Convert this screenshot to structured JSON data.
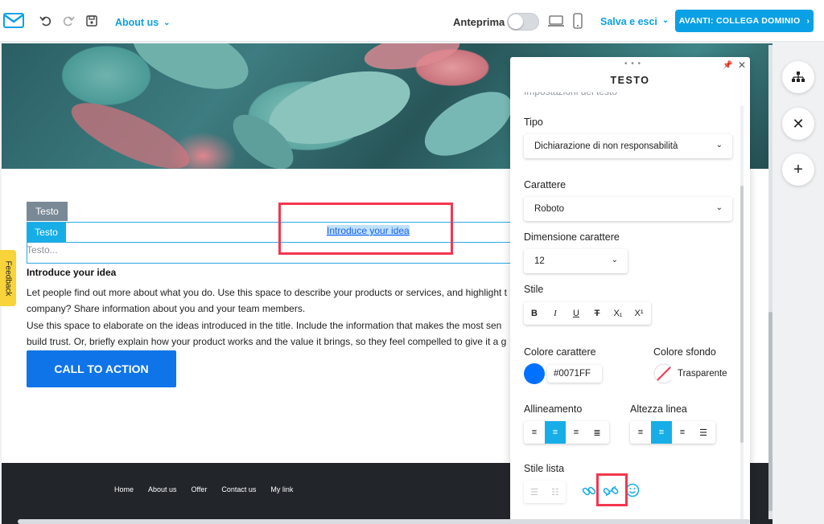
{
  "topbar": {
    "page_menu_label": "About us",
    "preview_label": "Anteprima",
    "save_exit_label": "Salva e esci",
    "next_button_label": "AVANTI: COLLEGA DOMINIO"
  },
  "canvas": {
    "tag_gray": "Testo",
    "tag_blue": "Testo",
    "input_placeholder": "Testo...",
    "link_text": "Introduce your idea",
    "intro_title": "Introduce your idea",
    "paragraphs": [
      "Let people find out more about what you do. Use this space to describe your products or services, and highlight t",
      "company? Share information about you and your team members.",
      "Use this space to elaborate on the ideas introduced in the title. Include the information that makes the most sen",
      "build trust. Or, briefly explain how your product works and the value it brings, so they feel compelled to give it a g"
    ],
    "cta_label": "CALL TO ACTION",
    "footer_nav": [
      "Home",
      "About us",
      "Offer",
      "Contact us",
      "My link"
    ],
    "feedback_label": "Feedback"
  },
  "panel": {
    "dots": "• • •",
    "title": "TESTO",
    "subtitle": "Impostazioni del testo",
    "tipo_label": "Tipo",
    "tipo_value": "Dichiarazione di non responsabilità",
    "carattere_label": "Carattere",
    "carattere_value": "Roboto",
    "dimensione_label": "Dimensione carattere",
    "dimensione_value": "12",
    "stile_label": "Stile",
    "stile_buttons": [
      "B",
      "I",
      "U",
      "T",
      "X₁",
      "X¹"
    ],
    "colore_carattere_label": "Colore carattere",
    "colore_carattere_value": "#0071FF",
    "colore_sfondo_label": "Colore sfondo",
    "colore_sfondo_value": "Trasparente",
    "allineamento_label": "Allineamento",
    "altezza_linea_label": "Altezza linea",
    "stile_lista_label": "Stile lista"
  },
  "colors": {
    "accent": "#0AA0E6",
    "text_color": "#0071FF",
    "cta": "#0F74E8",
    "highlight_red": "#F5364F",
    "feedback": "#F8D33A"
  }
}
